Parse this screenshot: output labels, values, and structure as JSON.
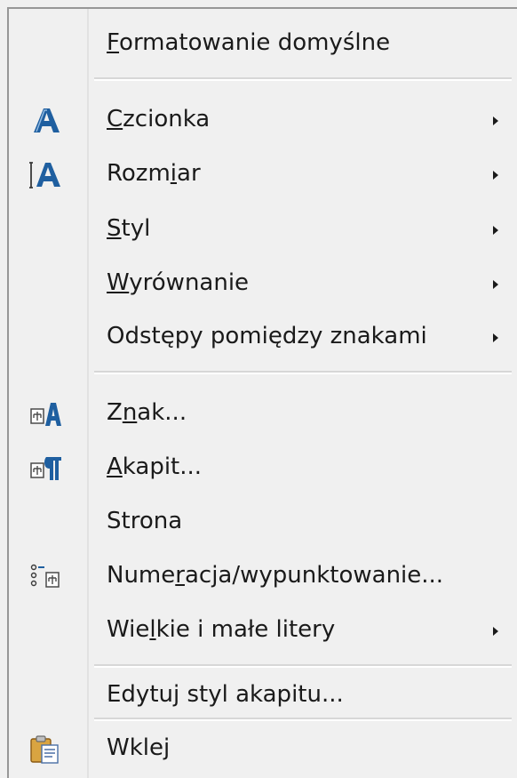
{
  "menu": {
    "items": [
      {
        "pre": "",
        "mn": "F",
        "post": "ormatowanie domyślne"
      },
      {
        "pre": "",
        "mn": "C",
        "post": "zcionka",
        "icon": "font-icon"
      },
      {
        "pre": "Rozm",
        "mn": "i",
        "post": "ar",
        "icon": "font-size-icon"
      },
      {
        "pre": "",
        "mn": "S",
        "post": "tyl"
      },
      {
        "pre": "",
        "mn": "W",
        "post": "yrównanie"
      },
      {
        "pre": "Odstępy pomiędzy znakami",
        "mn": "",
        "post": ""
      },
      {
        "pre": "Z",
        "mn": "n",
        "post": "ak...",
        "icon": "character-dialog-icon"
      },
      {
        "pre": "",
        "mn": "A",
        "post": "kapit...",
        "icon": "paragraph-dialog-icon"
      },
      {
        "pre": "Strona",
        "mn": "",
        "post": ""
      },
      {
        "pre": "Nume",
        "mn": "r",
        "post": "acja/wypunktowanie...",
        "icon": "bullets-numbering-icon"
      },
      {
        "pre": "Wie",
        "mn": "l",
        "post": "kie i małe litery"
      },
      {
        "pre": "Edytuj styl akapitu...",
        "mn": "",
        "post": ""
      },
      {
        "pre": "Wkle",
        "mn": "j",
        "post": "",
        "icon": "paste-clipboard-icon"
      }
    ]
  },
  "colors": {
    "menu_bg": "#f0f0f0",
    "text": "#1a1a1a",
    "icon_blue": "#1f5fa0"
  }
}
